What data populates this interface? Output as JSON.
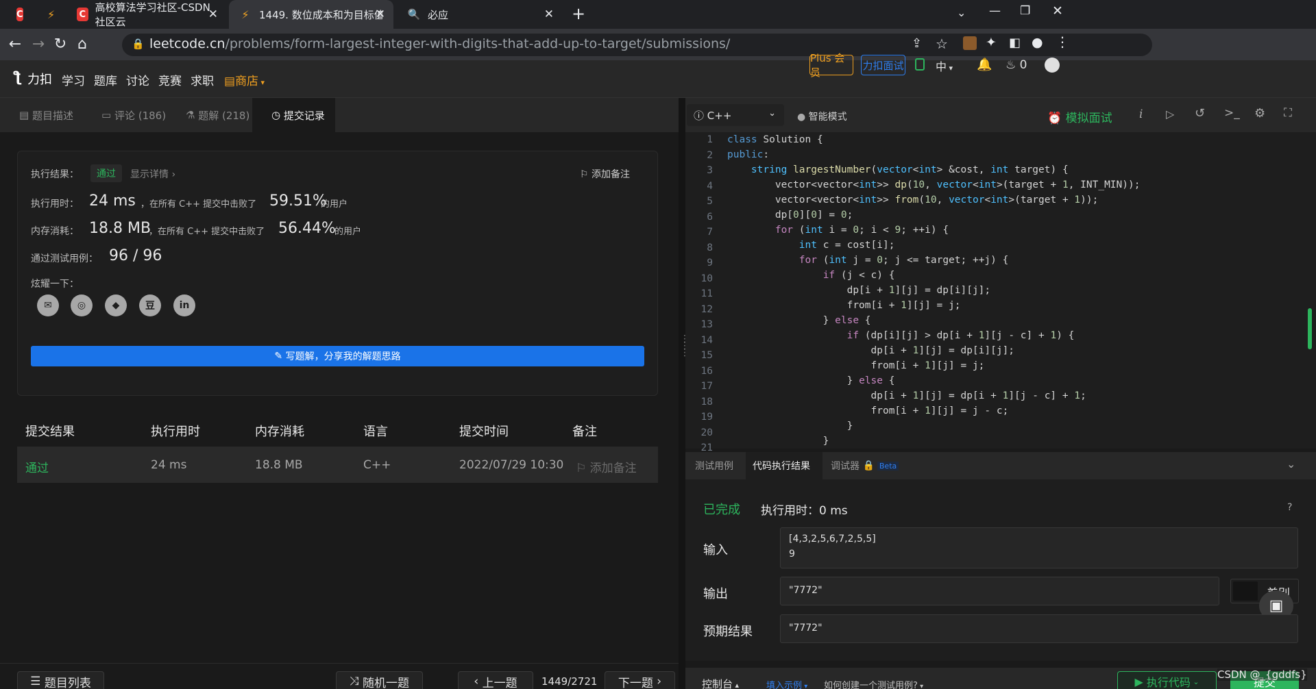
{
  "browser": {
    "tabs": [
      {
        "title": ""
      },
      {
        "title": ""
      },
      {
        "title": "高校算法学习社区-CSDN社区云"
      },
      {
        "title": "1449. 数位成本和为目标值的最大"
      },
      {
        "title": "必应"
      }
    ],
    "url_host": "leetcode.cn",
    "url_path": "/problems/form-largest-integer-with-digits-that-add-up-to-target/submissions/"
  },
  "header": {
    "logo": "力扣",
    "nav": [
      "学习",
      "题库",
      "讨论",
      "竞赛",
      "求职"
    ],
    "shop": "商店",
    "plus": "Plus 会员",
    "interview": "力扣面试",
    "lang": "中",
    "points": "0"
  },
  "left_tabs": [
    {
      "label": "题目描述"
    },
    {
      "label": "评论 (186)"
    },
    {
      "label": "题解 (218)"
    },
    {
      "label": "提交记录"
    }
  ],
  "result": {
    "result_label": "执行结果：",
    "status": "通过",
    "detail": "显示详情",
    "add_note": "添加备注",
    "time_label": "执行用时：",
    "time_value": "24 ms",
    "time_desc": "，在所有 C++ 提交中击败了",
    "time_pct": "59.51%",
    "time_suffix": "的用户",
    "mem_label": "内存消耗：",
    "mem_value": "18.8 MB",
    "mem_desc": "，在所有 C++ 提交中击败了",
    "mem_pct": "56.44%",
    "mem_suffix": "的用户",
    "tests_label": "通过测试用例：",
    "tests_value": "96 / 96",
    "share_label": "炫耀一下：",
    "write_button": "写题解，分享我的解题思路"
  },
  "table": {
    "headers": [
      "提交结果",
      "执行用时",
      "内存消耗",
      "语言",
      "提交时间",
      "备注"
    ],
    "row": {
      "status": "通过",
      "time": "24 ms",
      "memory": "18.8 MB",
      "lang": "C++",
      "date": "2022/07/29 10:30",
      "note": "添加备注"
    }
  },
  "bottom_nav": {
    "list": "题目列表",
    "random": "随机一题",
    "prev": "上一题",
    "page": "1449/2721",
    "next": "下一题"
  },
  "editor": {
    "language": "C++",
    "mode": "智能模式",
    "mock": "模拟面试",
    "line_numbers": [
      "1",
      "2",
      "3",
      "4",
      "5",
      "6",
      "7",
      "8",
      "9",
      "10",
      "11",
      "12",
      "13",
      "14",
      "15",
      "16",
      "17",
      "18",
      "19",
      "20",
      "21"
    ]
  },
  "result_tabs": [
    {
      "label": "测试用例"
    },
    {
      "label": "代码执行结果"
    },
    {
      "label": "调试器"
    }
  ],
  "beta": "Beta",
  "run": {
    "status": "已完成",
    "time": "执行用时：0 ms",
    "input_label": "输入",
    "input_value": "[4,3,2,5,6,7,2,5,5]\n9",
    "output_label": "输出",
    "output_value": "\"7772\"",
    "diff": "差别",
    "expected_label": "预期结果",
    "expected_value": "\"7772\""
  },
  "footer": {
    "console": "控制台",
    "fill_example": "填入示例",
    "how_to": "如何创建一个测试用例?",
    "run_code": "执行代码",
    "submit": "提交"
  },
  "watermark": "CSDN @_{gddfs}"
}
